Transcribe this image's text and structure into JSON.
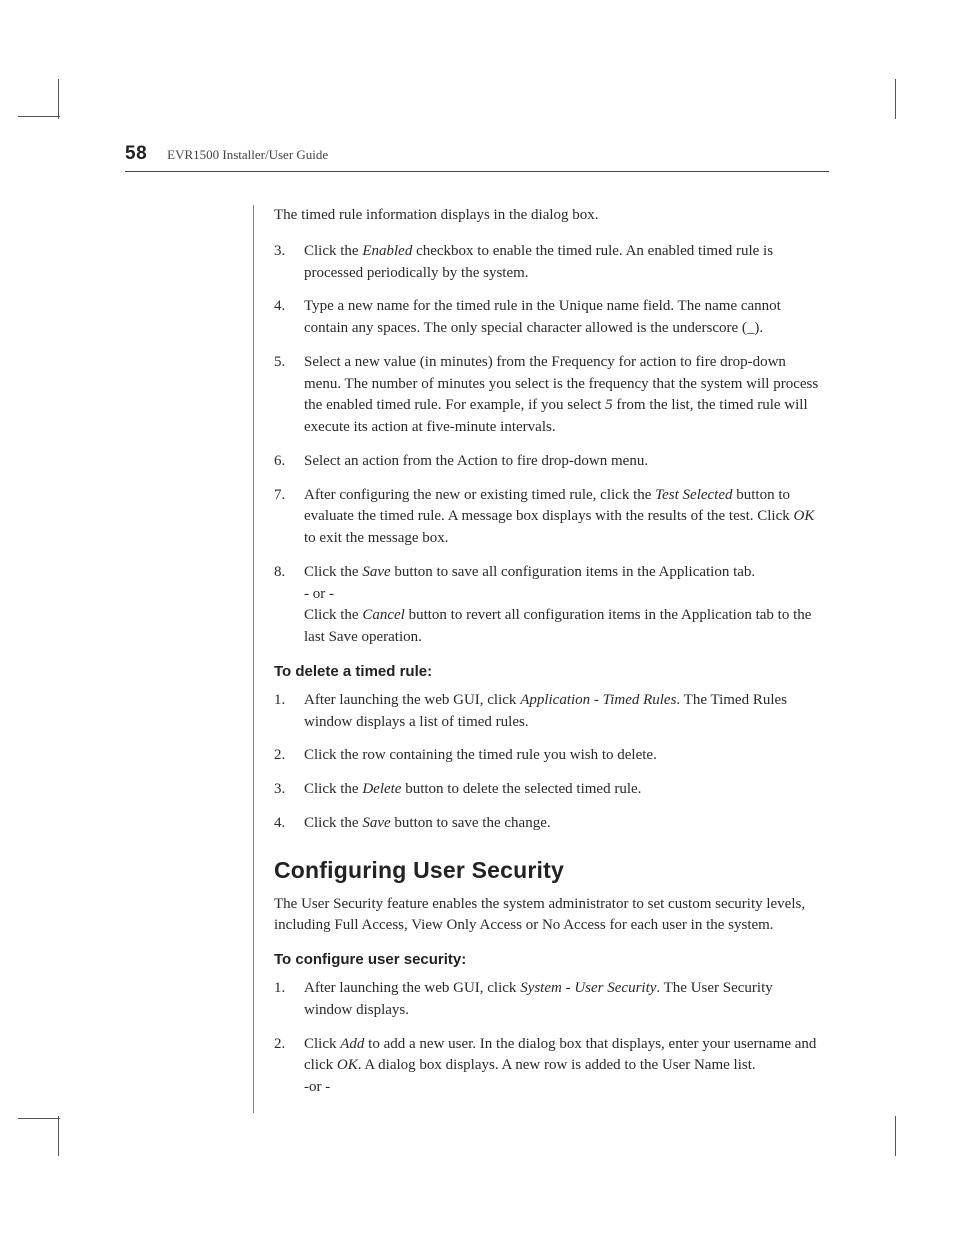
{
  "header": {
    "page_number": "58",
    "doc_title": "EVR1500 Installer/User Guide"
  },
  "section1": {
    "intro": "The timed rule information displays in the dialog box.",
    "items": [
      {
        "n": "3.",
        "pre": "Click the ",
        "em": "Enabled",
        "post": " checkbox to enable the timed rule. An enabled timed rule is processed periodically by the system."
      },
      {
        "n": "4.",
        "pre": "",
        "em": "",
        "post": "Type a new name for the timed rule in the Unique name field. The name cannot contain any spaces. The only special character allowed is the underscore (_)."
      },
      {
        "n": "5.",
        "pre": "",
        "em": "",
        "post": "Select a new value (in minutes) from the Frequency for action to fire drop-down menu. The number of minutes you select is the frequency that the system will process the enabled timed rule. For example, if you select ",
        "em2": "5",
        "post2": " from the list, the timed rule will execute its action at five-minute intervals."
      },
      {
        "n": "6.",
        "pre": "",
        "em": "",
        "post": "Select an action from the Action to fire drop-down menu."
      },
      {
        "n": "7.",
        "pre": "After configuring the new or existing timed rule, click the ",
        "em": "Test Selected",
        "post": " button to evaluate the timed rule. A message box displays with the results of the test. Click ",
        "em2": "OK",
        "post2": " to exit the message box."
      },
      {
        "n": "8.",
        "pre": "Click the ",
        "em": "Save",
        "post": " button to save all configuration items in the Application tab.",
        "line2_pre": "- or -",
        "line3_pre": "Click the ",
        "line3_em": "Cancel",
        "line3_post": " button to revert all configuration items in the Application tab to the last Save operation."
      }
    ]
  },
  "section2": {
    "heading": "To delete a timed rule:",
    "items": [
      {
        "n": "1.",
        "pre": "After launching the web GUI, click ",
        "em": "Application - Timed Rules",
        "post": ". The Timed Rules window displays a list of timed rules."
      },
      {
        "n": "2.",
        "pre": "",
        "em": "",
        "post": "Click the row containing the timed rule you wish to delete."
      },
      {
        "n": "3.",
        "pre": "Click the ",
        "em": "Delete",
        "post": " button to delete the selected timed rule."
      },
      {
        "n": "4.",
        "pre": "Click the ",
        "em": "Save",
        "post": " button to save the change."
      }
    ]
  },
  "section3": {
    "h2": "Configuring User Security",
    "para": "The User Security feature enables the system administrator to set custom security levels, including Full Access, View Only Access or No Access for each user in the system.",
    "subhead": "To configure user security:",
    "items": [
      {
        "n": "1.",
        "pre": "After launching the web GUI, click ",
        "em": "System - User Security",
        "post": ". The User Security window displays."
      },
      {
        "n": "2.",
        "pre": "Click ",
        "em": "Add",
        "post": " to add a new user. In the dialog box that displays, enter your username and click ",
        "em2": "OK",
        "post2": ". A dialog box displays. A new row is added to the User Name list.",
        "line2_pre": "-or -"
      }
    ]
  }
}
